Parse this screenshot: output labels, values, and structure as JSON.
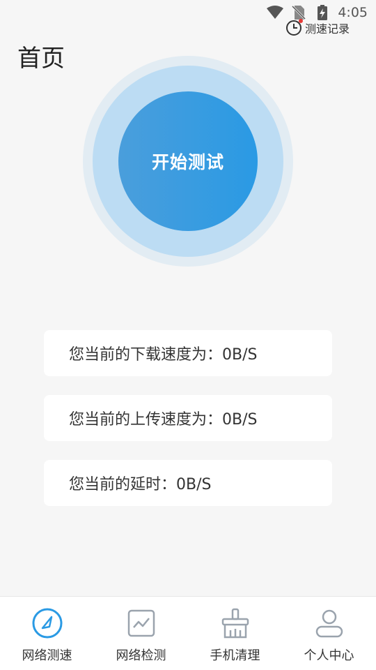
{
  "status_bar": {
    "time": "4:05",
    "icons": [
      "wifi-icon",
      "no-sim-icon",
      "battery-charging-icon"
    ]
  },
  "header": {
    "title": "首页",
    "record_label": "测速记录",
    "record_icon": "clock-icon"
  },
  "test": {
    "start_label": "开始测试"
  },
  "stats": {
    "download": "您当前的下载速度为：0B/S",
    "upload": "您当前的上传速度为：0B/S",
    "latency": "您当前的延时：0B/S"
  },
  "nav": {
    "items": [
      {
        "label": "网络测速",
        "icon": "speedometer-icon",
        "active": true
      },
      {
        "label": "网络检测",
        "icon": "chart-line-icon",
        "active": false
      },
      {
        "label": "手机清理",
        "icon": "broom-icon",
        "active": false
      },
      {
        "label": "个人中心",
        "icon": "person-icon",
        "active": false
      }
    ]
  },
  "colors": {
    "accent": "#2a9ae4",
    "ring_outer": "#e2ecf3",
    "ring_mid": "#bcdcf3",
    "inactive_icon": "#9aa3ad",
    "background": "#f6f6f6"
  }
}
